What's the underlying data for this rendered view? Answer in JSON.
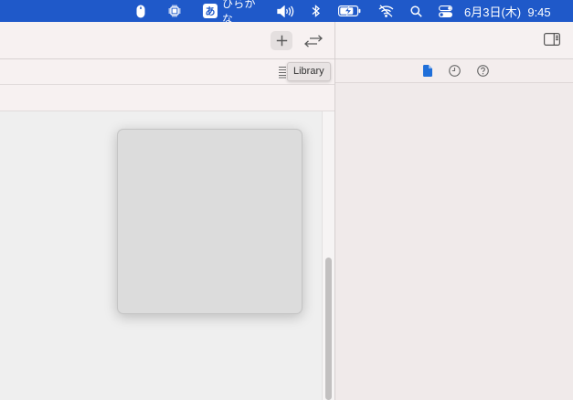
{
  "menubar": {
    "ime_glyph": "あ",
    "ime_label": "ひらがな",
    "clock": "6月3日(木)  9:45",
    "icons": [
      "mouse-icon",
      "cpu-icon",
      "input-source-icon",
      "volume-icon",
      "bluetooth-icon",
      "battery-icon",
      "wifi-off-icon",
      "spotlight-icon",
      "control-center-icon"
    ]
  },
  "toolbar": {
    "add_icon": "plus-icon",
    "swap_icon": "swap-arrows-icon"
  },
  "editor": {
    "tooltip": "Library"
  },
  "inspector": {
    "tabs": [
      "file-inspector-icon",
      "history-inspector-icon",
      "help-inspector-icon"
    ],
    "active_tab_color": "#1f6fd9"
  },
  "colors": {
    "menubar": "#1f59c9",
    "accent": "#1f6fd9"
  }
}
